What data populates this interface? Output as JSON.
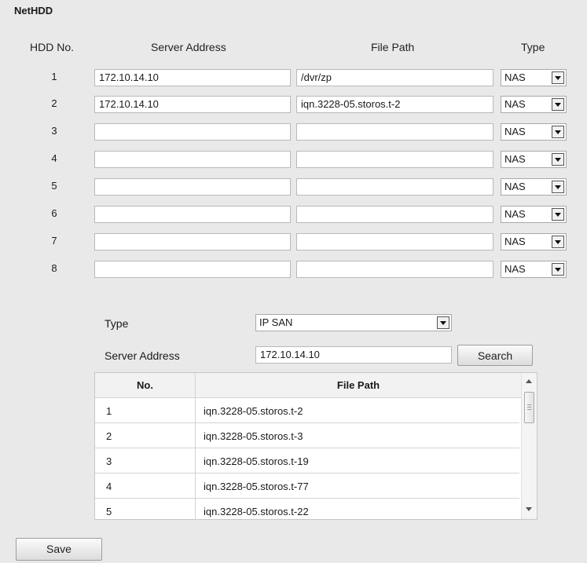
{
  "section": {
    "title": "NetHDD"
  },
  "columns": {
    "hdd_no": "HDD No.",
    "server_address": "Server Address",
    "file_path": "File Path",
    "type": "Type"
  },
  "hdds": [
    {
      "no": "1",
      "server": "172.10.14.10",
      "path": "/dvr/zp",
      "type": "NAS"
    },
    {
      "no": "2",
      "server": "172.10.14.10",
      "path": "iqn.3228-05.storos.t-2",
      "type": "NAS"
    },
    {
      "no": "3",
      "server": "",
      "path": "",
      "type": "NAS"
    },
    {
      "no": "4",
      "server": "",
      "path": "",
      "type": "NAS"
    },
    {
      "no": "5",
      "server": "",
      "path": "",
      "type": "NAS"
    },
    {
      "no": "6",
      "server": "",
      "path": "",
      "type": "NAS"
    },
    {
      "no": "7",
      "server": "",
      "path": "",
      "type": "NAS"
    },
    {
      "no": "8",
      "server": "",
      "path": "",
      "type": "NAS"
    }
  ],
  "search_panel": {
    "type_label": "Type",
    "type_value": "IP SAN",
    "server_label": "Server Address",
    "server_value": "172.10.14.10",
    "search_button": "Search"
  },
  "results": {
    "headers": {
      "no": "No.",
      "file_path": "File Path"
    },
    "rows": [
      {
        "no": "1",
        "path": "iqn.3228-05.storos.t-2"
      },
      {
        "no": "2",
        "path": "iqn.3228-05.storos.t-3"
      },
      {
        "no": "3",
        "path": "iqn.3228-05.storos.t-19"
      },
      {
        "no": "4",
        "path": "iqn.3228-05.storos.t-77"
      },
      {
        "no": "5",
        "path": "iqn.3228-05.storos.t-22"
      }
    ],
    "icons": {
      "scroll_up": "scroll-up-icon",
      "scroll_down": "scroll-down-icon"
    }
  },
  "footer": {
    "save_button": "Save"
  },
  "colors": {
    "background": "#e9e9e9",
    "field": "#ffffff",
    "border": "#b9b9b9"
  }
}
